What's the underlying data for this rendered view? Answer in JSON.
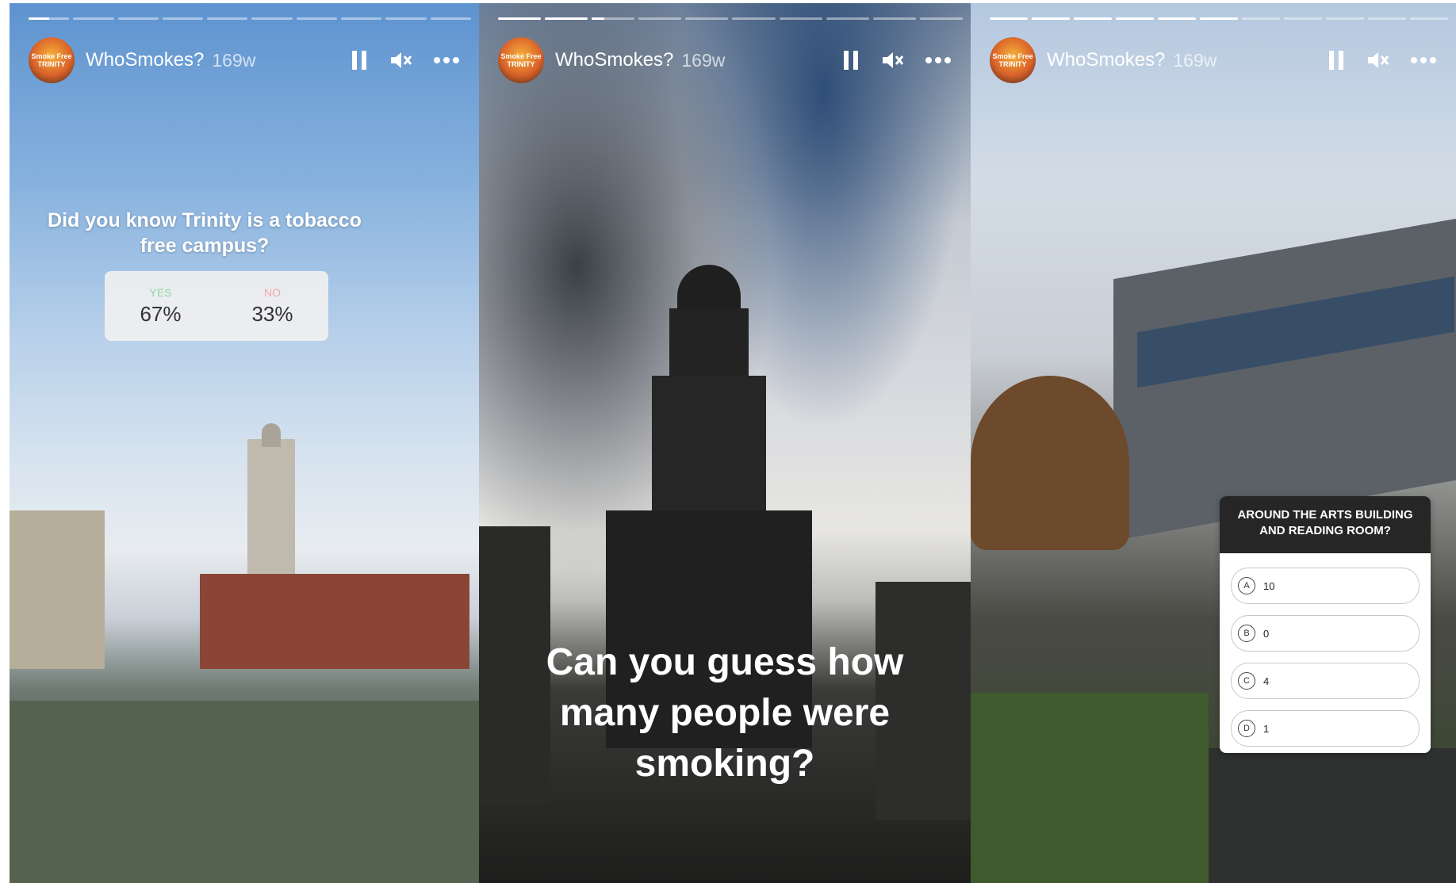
{
  "stories": [
    {
      "progress": [
        0.5,
        0,
        0,
        0,
        0,
        0,
        0,
        0,
        0,
        0
      ],
      "avatar_text": "Smoke Free TRINITY",
      "username": "WhoSmokes?",
      "age": "169w",
      "poll": {
        "question": "Did you know Trinity is a tobacco free campus?",
        "options": [
          {
            "label": "YES",
            "percent": "67%",
            "color": "#8ed6a4"
          },
          {
            "label": "NO",
            "percent": "33%",
            "color": "#f4a6a6"
          }
        ]
      }
    },
    {
      "progress": [
        1,
        1,
        0.3,
        0,
        0,
        0,
        0,
        0,
        0,
        0
      ],
      "avatar_text": "Smoke Free TRINITY",
      "username": "WhoSmokes?",
      "age": "169w",
      "caption": "Can you guess how many people were smoking?"
    },
    {
      "progress": [
        1,
        1,
        1,
        1,
        1,
        1,
        0,
        0,
        0,
        0,
        0
      ],
      "avatar_text": "Smoke Free TRINITY",
      "username": "WhoSmokes?",
      "age": "169w",
      "quiz": {
        "question": "AROUND THE ARTS BUILDING AND READING ROOM?",
        "options": [
          {
            "letter": "A",
            "value": "10"
          },
          {
            "letter": "B",
            "value": "0"
          },
          {
            "letter": "C",
            "value": "4"
          },
          {
            "letter": "D",
            "value": "1"
          }
        ]
      }
    }
  ],
  "icons": [
    "pause-icon",
    "mute-icon",
    "more-options-icon"
  ]
}
